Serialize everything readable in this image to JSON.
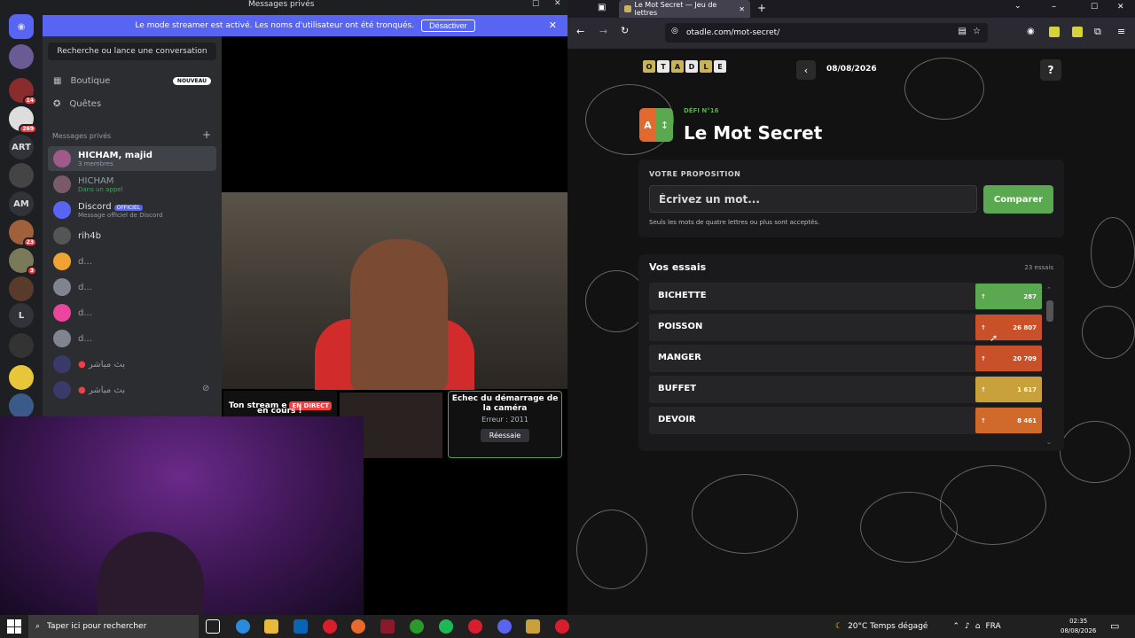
{
  "discord": {
    "window_title": "Messages privés",
    "streamer_banner": {
      "text": "Le mode streamer est activé. Les noms d'utilisateur ont été tronqués.",
      "button": "Désactiver"
    },
    "guild_badges": [
      "14",
      "269",
      "23",
      "3"
    ],
    "guild_labels": [
      "ART",
      "AM",
      "L"
    ],
    "search_placeholder": "Recherche ou lance une conversation",
    "nav": [
      {
        "label": "Boutique",
        "tag": "NOUVEAU"
      },
      {
        "label": "Quêtes"
      }
    ],
    "dm_header": "Messages privés",
    "dms": [
      {
        "name": "HICHAM, majid",
        "sub": "3 membres"
      },
      {
        "name": "HICHAM",
        "sub": "Dans un appel"
      },
      {
        "name": "Discord",
        "badge": "OFFICIEL",
        "sub": "Message officiel de Discord"
      },
      {
        "name": "rih4b"
      },
      {
        "name": "d..."
      },
      {
        "name": "d..."
      },
      {
        "name": "d..."
      },
      {
        "name": "d..."
      },
      {
        "name": "بث مباشر"
      },
      {
        "name": "بث مباشر"
      }
    ],
    "call": {
      "stream_tile_text": "Ton stream e",
      "stream_tile_text2": "en cours !",
      "live_badge": "EN DIRECT",
      "error_title": "Echec du démarrage de la caméra",
      "error_code": "Erreur : 2011",
      "retry_button": "Réessaie"
    }
  },
  "browser": {
    "tab_title": "Le Mot Secret — Jeu de lettres",
    "url": "otadle.com/mot-secret/",
    "colors": {
      "green": "#5aa850",
      "orange": "#e36a2e",
      "gold": "#c9b458"
    }
  },
  "game": {
    "logo_letters": [
      "O",
      "T",
      "A",
      "D",
      "L",
      "E"
    ],
    "back_button": "‹",
    "date": "08/08/2026",
    "help_button": "?",
    "icon_letter": "A",
    "icon_arrow": "↕",
    "day_label": "DÉFI N°16",
    "title": "Le Mot Secret",
    "proposal_label": "VOTRE PROPOSITION",
    "input_placeholder": "Écrivez un mot...",
    "compare_button": "Comparer",
    "hint": "Seuls les mots de quatre lettres ou plus sont acceptés.",
    "guesses_title": "Vos essais",
    "guess_count": "23 essais",
    "guesses": [
      {
        "word": "BICHETTE",
        "arrow": "↑",
        "score": "287",
        "color": "#5aa850"
      },
      {
        "word": "POISSON",
        "arrow": "↑",
        "score": "26 807",
        "color": "#c8512a"
      },
      {
        "word": "MANGER",
        "arrow": "↑",
        "score": "20 709",
        "color": "#c8512a"
      },
      {
        "word": "BUFFET",
        "arrow": "↑",
        "score": "1 617",
        "color": "#c9a13a"
      },
      {
        "word": "DEVOIR",
        "arrow": "↑",
        "score": "8 461",
        "color": "#d06a2a"
      }
    ]
  },
  "taskbar": {
    "search_placeholder": "Taper ici pour rechercher",
    "weather": "20°C  Temps dégagé",
    "lang": "FRA",
    "time": "02:35",
    "date": "08/08/2026"
  }
}
